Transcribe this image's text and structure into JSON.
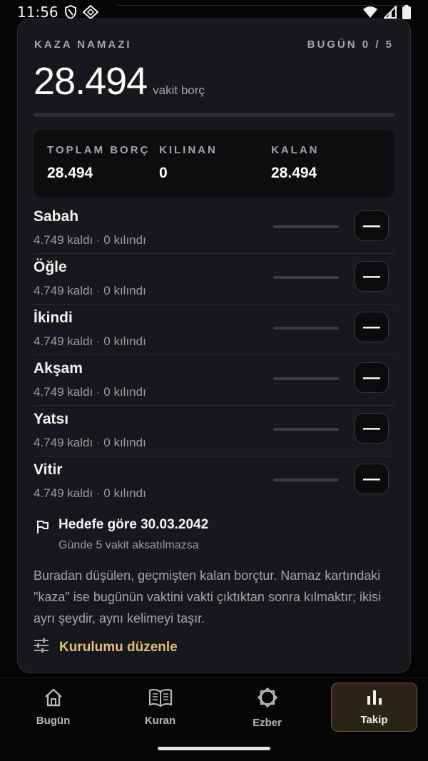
{
  "status_bar": {
    "time": "11:56",
    "icons": [
      "shield-icon",
      "vpn-icon",
      "wifi-icon",
      "signal-icon",
      "battery-icon"
    ]
  },
  "card": {
    "title": "KAZA NAMAZI",
    "today": "BUGÜN 0 / 5",
    "total": "28.494",
    "total_unit": "vakit borç",
    "progress_fraction": 0,
    "summary": {
      "total_label": "TOPLAM BORÇ",
      "total_value": "28.494",
      "done_label": "KILINAN",
      "done_value": "0",
      "left_label": "KALAN",
      "left_value": "28.494"
    },
    "prayers": [
      {
        "name": "Sabah",
        "detail": "4.749 kaldı · 0 kılındı",
        "progress": 0
      },
      {
        "name": "Öğle",
        "detail": "4.749 kaldı · 0 kılındı",
        "progress": 0
      },
      {
        "name": "İkindi",
        "detail": "4.749 kaldı · 0 kılındı",
        "progress": 0
      },
      {
        "name": "Akşam",
        "detail": "4.749 kaldı · 0 kılındı",
        "progress": 0
      },
      {
        "name": "Yatsı",
        "detail": "4.749 kaldı · 0 kılındı",
        "progress": 0
      },
      {
        "name": "Vitir",
        "detail": "4.749 kaldı · 0 kılındı",
        "progress": 0
      }
    ],
    "minus_label": "—",
    "goal_title": "Hedefe göre 30.03.2042",
    "goal_sub": "Günde 5 vakit aksatılmazsa",
    "note": "Buradan düşülen, geçmişten kalan borçtur. Namaz kartındaki \"kaza\" ise bugünün vaktini vakti çıktıktan sonra kılmaktır; ikisi ayrı şeydir, aynı kelimeyi taşır.",
    "edit_label": "Kurulumu düzenle"
  },
  "nav": {
    "tabs": [
      {
        "label": "Bugün",
        "icon": "home-icon",
        "active": false
      },
      {
        "label": "Kuran",
        "icon": "book-icon",
        "active": false
      },
      {
        "label": "Ezber",
        "icon": "star-icon",
        "active": false
      },
      {
        "label": "Takip",
        "icon": "bar-chart-icon",
        "active": true
      }
    ]
  },
  "colors": {
    "accent": "#e2bf7a",
    "card_bg": "#16181b",
    "background": "#050505"
  }
}
